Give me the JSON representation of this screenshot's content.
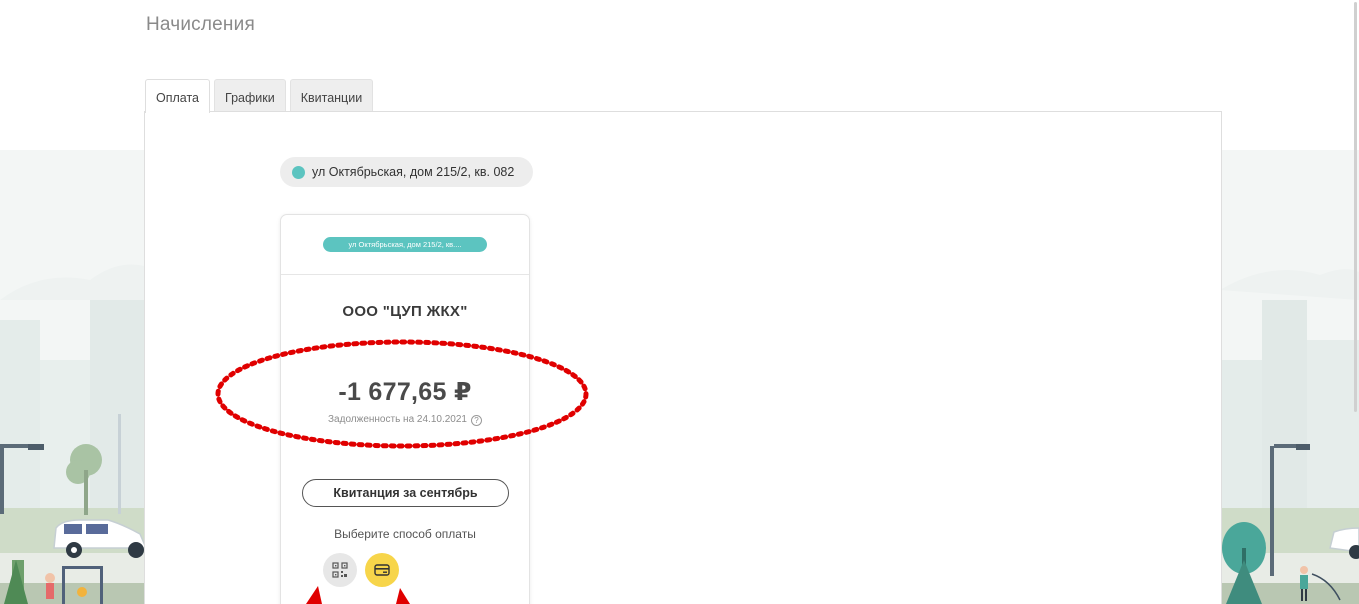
{
  "page": {
    "title": "Начисления"
  },
  "tabs": [
    {
      "label": "Оплата",
      "active": true
    },
    {
      "label": "Графики",
      "active": false
    },
    {
      "label": "Квитанции",
      "active": false
    }
  ],
  "address_chip": {
    "label": "ул Октябрьская, дом 215/2, кв. 082",
    "dot_color": "#5cc4c0"
  },
  "card": {
    "badge": "ул Октябрьская, дом 215/2, кв....",
    "company": "ООО \"ЦУП ЖКХ\"",
    "amount": "-1 677,65 ₽",
    "debt_note": "Задолженность на 24.10.2021",
    "help_icon": "?",
    "receipt_button": "Квитанция за сентябрь",
    "pay_method_label": "Выберите способ оплаты",
    "pay_methods": [
      {
        "icon": "qr-code-icon",
        "color": "#e7e7e7"
      },
      {
        "icon": "credit-card-icon",
        "color": "#f7d54a"
      }
    ]
  },
  "colors": {
    "accent": "#5cc4c0",
    "pay_card": "#f7d54a",
    "annotation": "#e00000"
  }
}
